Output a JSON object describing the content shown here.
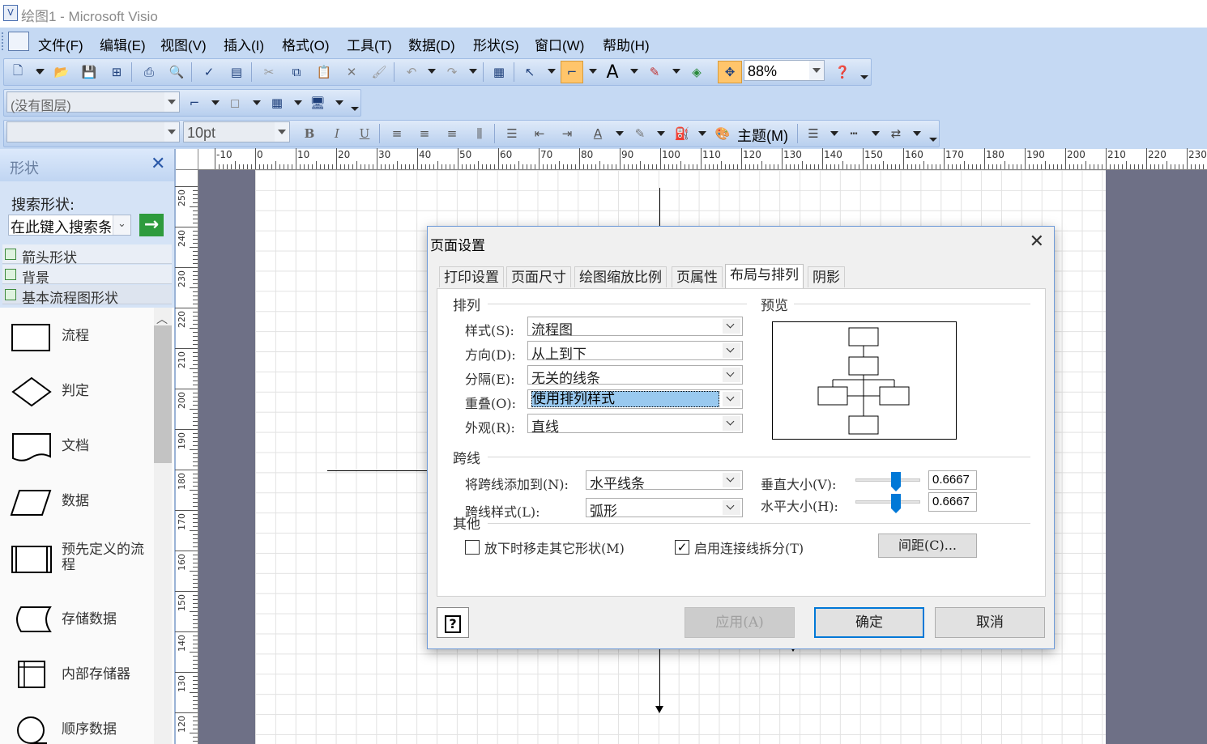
{
  "window": {
    "title": "绘图1 - Microsoft Visio"
  },
  "menu": [
    "文件(F)",
    "编辑(E)",
    "视图(V)",
    "插入(I)",
    "格式(O)",
    "工具(T)",
    "数据(D)",
    "形状(S)",
    "窗口(W)",
    "帮助(H)"
  ],
  "toolbar": {
    "zoom": "88%",
    "layer": "(没有图层)",
    "font_name": "",
    "font_size": "10pt",
    "theme_label": "主题(M)",
    "bold": "B",
    "italic": "I",
    "underline": "U"
  },
  "shapes_panel": {
    "title": "形状",
    "search_label": "搜索形状:",
    "search_placeholder": "在此键入搜索条",
    "stencils": [
      "箭头形状",
      "背景",
      "基本流程图形状"
    ],
    "items": [
      "流程",
      "判定",
      "文档",
      "数据",
      "预先定义的流程",
      "存储数据",
      "内部存储器",
      "顺序数据"
    ]
  },
  "rulers": {
    "horizontal": [
      "-10",
      "0",
      "10",
      "20",
      "30",
      "40",
      "50",
      "60",
      "70",
      "80",
      "90",
      "100",
      "110",
      "120",
      "130",
      "140",
      "150",
      "160",
      "170",
      "180",
      "190",
      "200",
      "210",
      "220",
      "230"
    ],
    "vertical": [
      "250",
      "240",
      "230",
      "220",
      "210",
      "200",
      "190",
      "180",
      "170",
      "160",
      "150",
      "140",
      "130",
      "120"
    ]
  },
  "dialog": {
    "title": "页面设置",
    "tabs": [
      "打印设置",
      "页面尺寸",
      "绘图缩放比例",
      "页属性",
      "布局与排列",
      "阴影"
    ],
    "active_tab": "布局与排列",
    "arrange_group": "排列",
    "preview_group": "预览",
    "fields": [
      {
        "label": "样式(S):",
        "value": "流程图"
      },
      {
        "label": "方向(D):",
        "value": "从上到下"
      },
      {
        "label": "分隔(E):",
        "value": "无关的线条"
      },
      {
        "label": "重叠(O):",
        "value": "使用排列样式"
      },
      {
        "label": "外观(R):",
        "value": "直线"
      }
    ],
    "jump_group": "跨线",
    "jump_add_label": "将跨线添加到(N):",
    "jump_add_value": "水平线条",
    "jump_style_label": "跨线样式(L):",
    "jump_style_value": "弧形",
    "vertical_size_label": "垂直大小(V):",
    "vertical_size_value": "0.6667",
    "horizontal_size_label": "水平大小(H):",
    "horizontal_size_value": "0.6667",
    "other_group": "其他",
    "move_shapes_label": "放下时移走其它形状(M)",
    "move_shapes_checked": false,
    "split_label": "启用连接线拆分(T)",
    "split_checked": true,
    "spacing_button": "间距(C)...",
    "help_button": "?",
    "apply_button": "应用(A)",
    "ok_button": "确定",
    "cancel_button": "取消"
  },
  "colors": {
    "chrome": "#c5d9f3",
    "canvas": "#6e7086",
    "accent": "#0078d7",
    "selection": "#99c9ef"
  }
}
